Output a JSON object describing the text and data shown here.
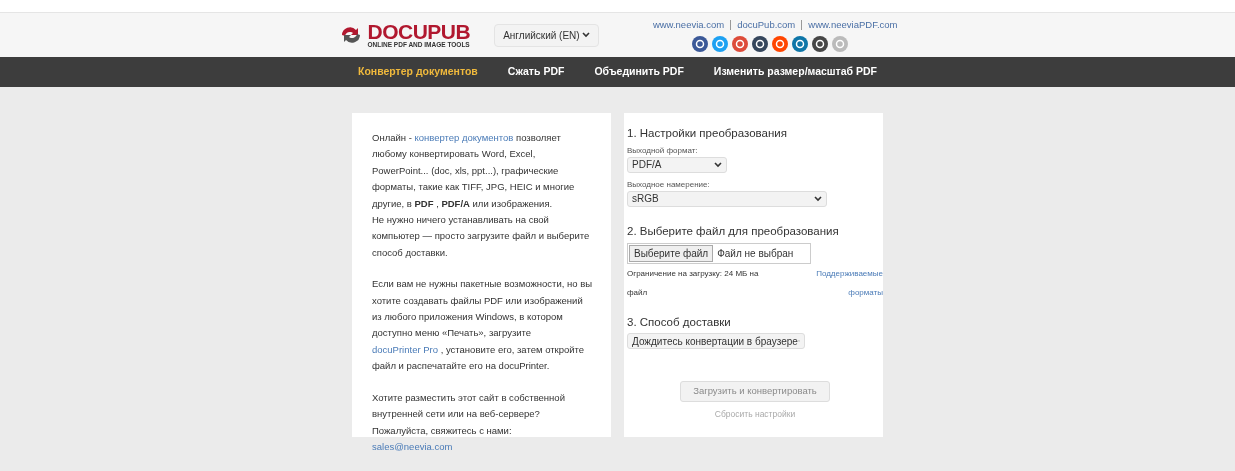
{
  "header": {
    "logo_title": "DOCUPUB",
    "logo_subtitle": "ONLINE PDF AND IMAGE TOOLS",
    "language": "Английский (EN)",
    "links": [
      "www.neevia.com",
      "docuPub.com",
      "www.neeviaPDF.com"
    ]
  },
  "nav": [
    {
      "label": "Конвертер документов",
      "selected": true
    },
    {
      "label": "Сжать PDF",
      "selected": false
    },
    {
      "label": "Объединить PDF",
      "selected": false
    },
    {
      "label": "Изменить размер/масштаб PDF",
      "selected": false
    }
  ],
  "intro": [
    [
      {
        "kind": "text",
        "text": "Онлайн - "
      },
      {
        "kind": "link",
        "text": "конвертер документов"
      },
      {
        "kind": "text",
        "text": " позволяет любому конвертировать Word, Excel, PowerPoint... (doc, xls, ppt...), графические форматы, такие как TIFF, JPG, HEIC и многие другие, в **PDF** , **PDF/A** или изображения."
      },
      {
        "kind": "break"
      },
      {
        "kind": "text",
        "text": "Не нужно ничего устанавливать на свой компьютер — просто загрузите файл и выберите способ доставки."
      }
    ],
    [
      {
        "kind": "text",
        "text": "Если вам не нужны пакетные возможности, но вы хотите создавать файлы PDF или изображений из любого приложения Windows, в котором доступно меню «Печать», загрузите "
      },
      {
        "kind": "link",
        "text": "docuPrinter Pro"
      },
      {
        "kind": "text",
        "text": " , установите его, затем откройте файл и распечатайте его на docuPrinter."
      }
    ],
    [
      {
        "kind": "text",
        "text": "Хотите разместить этот сайт в собственной внутренней сети или на веб-сервере? Пожалуйста, свяжитесь с нами:"
      },
      {
        "kind": "break"
      },
      {
        "kind": "link",
        "text": "sales@neevia.com"
      }
    ]
  ],
  "form": {
    "step1": {
      "title": "1. Настройки преобразования",
      "format_label": "Выходной формат:",
      "format": "PDF/A",
      "intent_label": "Выходное намерение:",
      "intent": "sRGB"
    },
    "step2": {
      "title": "2. Выберите файл для преобразования",
      "file_button": "Выберите файл",
      "file_status": "Файл не выбран",
      "limit": "Ограничение на загрузку: 24 МБ на файл",
      "formats_link": "Поддерживаемые форматы"
    },
    "step3": {
      "title": "3. Способ доставки",
      "delivery": "Дождитесь конвертации в браузере"
    },
    "submit": {
      "label": "Загрузить и конвертировать",
      "disabled": true
    },
    "reset": "Сбросить настройки"
  }
}
